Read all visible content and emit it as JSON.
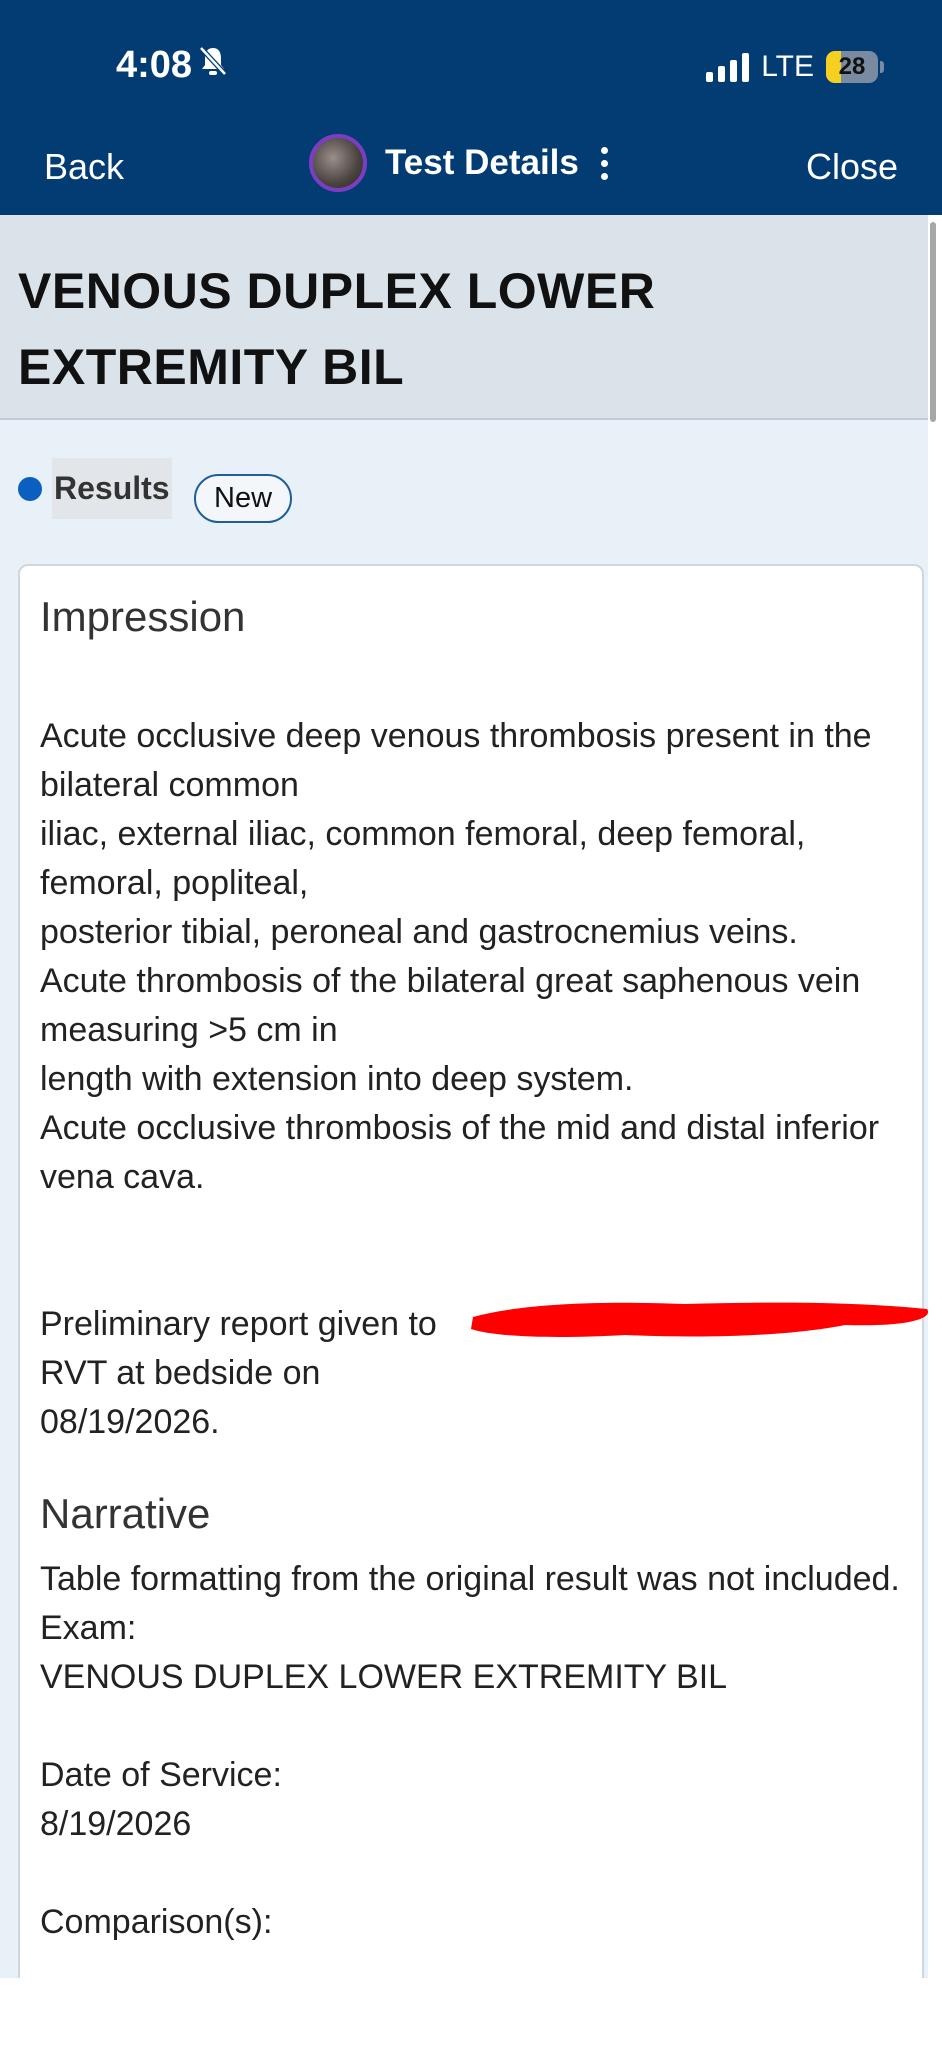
{
  "status_bar": {
    "time": "4:08",
    "network": "LTE",
    "battery": "28",
    "battery_level": 0.28,
    "bell_icon": "bell-slash-icon"
  },
  "nav": {
    "back_label": "Back",
    "title": "Test Details",
    "close_label": "Close"
  },
  "page": {
    "title": "VENOUS DUPLEX LOWER EXTREMITY BIL"
  },
  "results": {
    "label": "Results",
    "badge": "New"
  },
  "impression": {
    "heading": "Impression",
    "text": "Acute occlusive deep venous thrombosis present in the bilateral common\niliac, external iliac, common femoral, deep femoral, femoral, popliteal,\nposterior tibial, peroneal and gastrocnemius veins.\nAcute thrombosis of the bilateral great saphenous vein measuring >5 cm in\nlength with extension into deep system.\nAcute occlusive thrombosis of the mid and distal inferior vena cava.",
    "prelim_text": "Preliminary report given to\nRVT at bedside on\n08/19/2026."
  },
  "narrative": {
    "heading": "Narrative",
    "text": "Table formatting from the original result was not included.\nExam:\nVENOUS DUPLEX LOWER EXTREMITY BIL",
    "date_label": "Date of Service:",
    "date_value": "8/19/2026",
    "comparison_label": "Comparison(s):"
  },
  "colors": {
    "nav_bg": "#033c73",
    "accent_dot": "#0b5fc0",
    "redaction": "#ff0000"
  }
}
